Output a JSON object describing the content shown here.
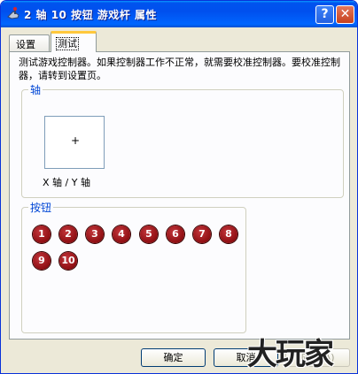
{
  "window": {
    "title": "2 轴 10 按钮 游戏杆 属性",
    "help_label": "?",
    "close_label": "✕"
  },
  "tabs": [
    {
      "label": "设置",
      "selected": false
    },
    {
      "label": "测试",
      "selected": true
    }
  ],
  "description": "测试游戏控制器。如果控制器工作不正常，就需要校准控制器。要校准控制器，请转到设置页。",
  "axes_group": {
    "title": "轴",
    "crosshair": "+",
    "label": "X 轴 / Y 轴"
  },
  "buttons_group": {
    "title": "按钮",
    "buttons": [
      "1",
      "2",
      "3",
      "4",
      "5",
      "6",
      "7",
      "8",
      "9",
      "10"
    ]
  },
  "footer": {
    "ok_label": "确定",
    "cancel_label": "取消",
    "apply_label": "应用(A)"
  },
  "watermark": "大玩家",
  "colors": {
    "titlebar": "#0054e3",
    "group_title": "#0046d5",
    "joystick_button": "#8e0e12"
  }
}
